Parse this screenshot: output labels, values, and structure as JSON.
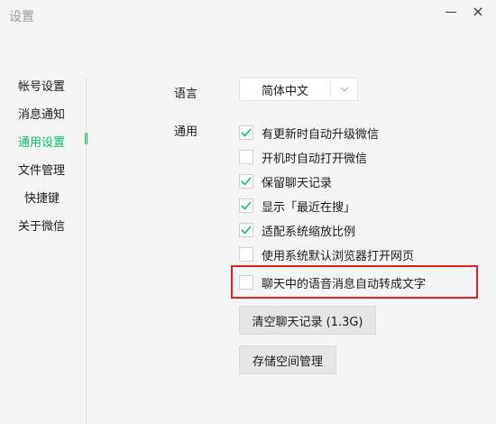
{
  "window": {
    "title": "设置",
    "minimize_icon": "minimize-icon",
    "close_label": "×"
  },
  "sidebar": {
    "items": [
      {
        "label": "帐号设置"
      },
      {
        "label": "消息通知"
      },
      {
        "label": "通用设置",
        "active": true
      },
      {
        "label": "文件管理"
      },
      {
        "label": "快捷键"
      },
      {
        "label": "关于微信"
      }
    ]
  },
  "language": {
    "label": "语言",
    "selected": "简体中文"
  },
  "general": {
    "label": "通用",
    "options": [
      {
        "label": "有更新时自动升级微信",
        "checked": true
      },
      {
        "label": "开机时自动打开微信",
        "checked": false
      },
      {
        "label": "保留聊天记录",
        "checked": true
      },
      {
        "label": "显示「最近在搜」",
        "checked": true
      },
      {
        "label": "适配系统缩放比例",
        "checked": true
      },
      {
        "label": "使用系统默认浏览器打开网页",
        "checked": false
      },
      {
        "label": "聊天中的语音消息自动转成文字",
        "checked": false,
        "highlighted": true
      }
    ]
  },
  "buttons": {
    "clear_history": "清空聊天记录 (1.3G)",
    "storage_manage": "存储空间管理"
  },
  "colors": {
    "accent": "#07c160",
    "highlight_border": "#e02020"
  }
}
